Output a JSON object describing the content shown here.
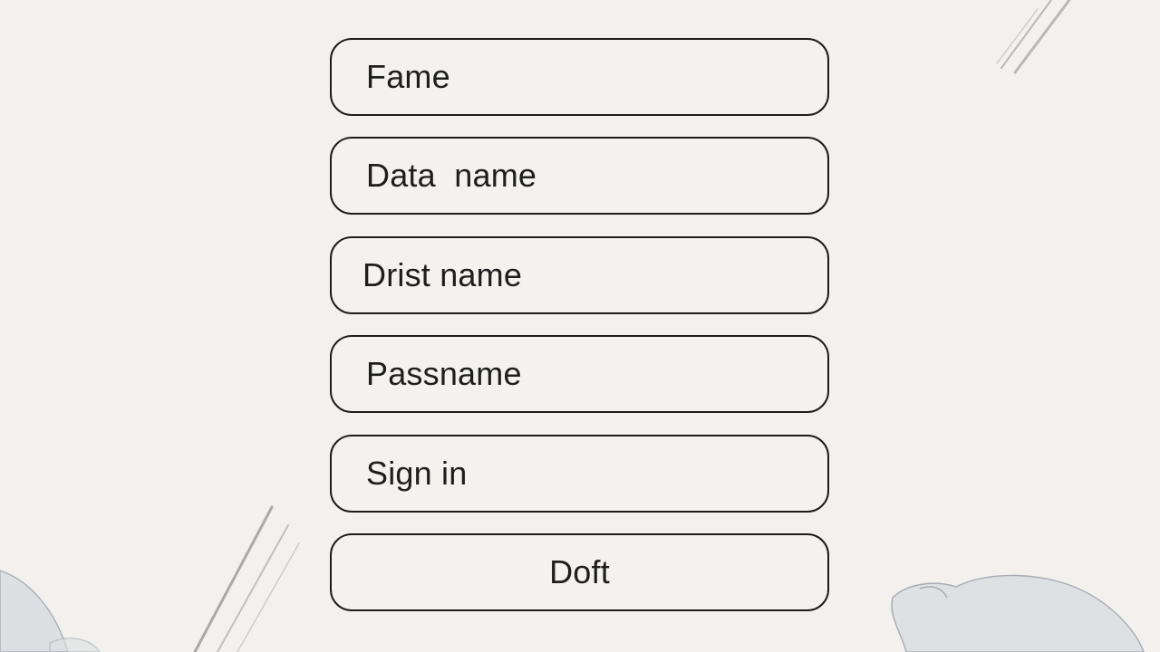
{
  "form": {
    "fields": [
      {
        "name": "fame-field",
        "value": "Fame"
      },
      {
        "name": "data-name-field",
        "value": "Data  name"
      },
      {
        "name": "drist-name-field",
        "value": "Drist name"
      },
      {
        "name": "passname-field",
        "value": "Passname"
      }
    ],
    "sign_in_label": "Sign in",
    "doft_label": "Doft"
  },
  "colors": {
    "background": "#f2f1ee",
    "border": "#1c1c1c",
    "text": "#1e1e1e"
  }
}
